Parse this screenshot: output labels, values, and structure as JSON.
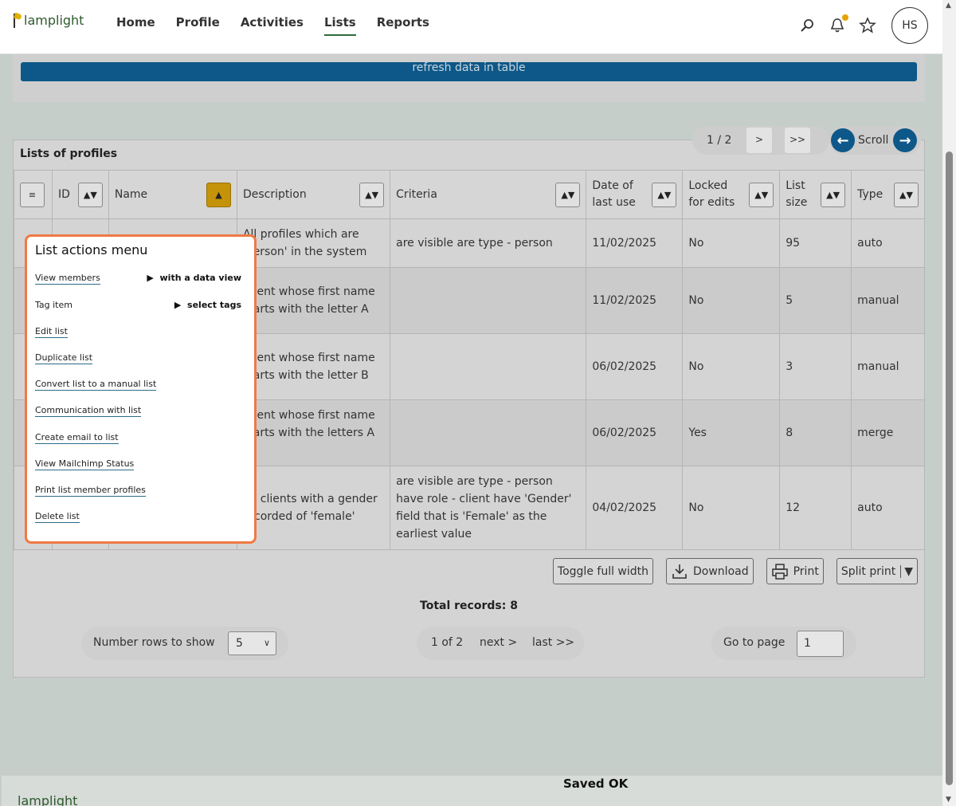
{
  "topbar": {
    "logo_text": "lamplight",
    "nav": [
      "Home",
      "Profile",
      "Activities",
      "Lists",
      "Reports"
    ],
    "active_nav": "Lists",
    "avatar_initials": "HS"
  },
  "upper_panel": {
    "refresh_label": "refresh data in table"
  },
  "panel": {
    "title": "Lists of profiles",
    "pager": {
      "count": "1 / 2",
      "next": ">",
      "last": ">>"
    },
    "scroll_label": "Scroll"
  },
  "table": {
    "columns": [
      "ID",
      "Name",
      "Description",
      "Criteria",
      "Date of last use",
      "Locked for edits",
      "List size",
      "Type"
    ],
    "sort_indicator": "▲▼",
    "sorted_indicator": "▲",
    "menu_glyph": "≡",
    "rows": [
      {
        "description": "All profiles which are 'person' in the system",
        "criteria": "are visible are type - person",
        "date": "11/02/2025",
        "locked": "No",
        "size": "95",
        "type": "auto"
      },
      {
        "description": "Client whose first name starts with the letter A",
        "criteria": "",
        "date": "11/02/2025",
        "locked": "No",
        "size": "5",
        "type": "manual"
      },
      {
        "description": "Client whose first name starts with the letter B",
        "criteria": "",
        "date": "06/02/2025",
        "locked": "No",
        "size": "3",
        "type": "manual"
      },
      {
        "description": "Client whose first name starts with the letters A B",
        "criteria": "",
        "date": "06/02/2025",
        "locked": "Yes",
        "size": "8",
        "type": "merge"
      },
      {
        "description": "All clients with a gender recorded of 'female'",
        "criteria": "are visible are type - person have role - client have 'Gender' field that is 'Female' as the earliest value",
        "date": "04/02/2025",
        "locked": "No",
        "size": "12",
        "type": "auto"
      }
    ]
  },
  "tools": {
    "toggle": "Toggle full width",
    "download": "Download",
    "print": "Print",
    "split_print": "Split print"
  },
  "footer_controls": {
    "total": "Total records: 8",
    "rows_label": "Number rows to show",
    "rows_value": "5",
    "page_text": "1 of 2",
    "next": "next >",
    "last": "last >>",
    "goto_label": "Go to page",
    "goto_value": "1"
  },
  "menu": {
    "title": "List actions menu",
    "items": [
      "View members",
      "Tag item",
      "Edit list",
      "Duplicate list",
      "Convert list to a manual list",
      "Communication with list",
      "Create email to list",
      "View Mailchimp Status",
      "Print list member profiles",
      "Delete list"
    ],
    "sub_view": "with a data view",
    "sub_tag": "select tags"
  },
  "status": {
    "saved": "Saved OK"
  },
  "colors": {
    "accent": "#0d5888",
    "highlight": "#f07a44",
    "sort_active": "#c4930a"
  }
}
